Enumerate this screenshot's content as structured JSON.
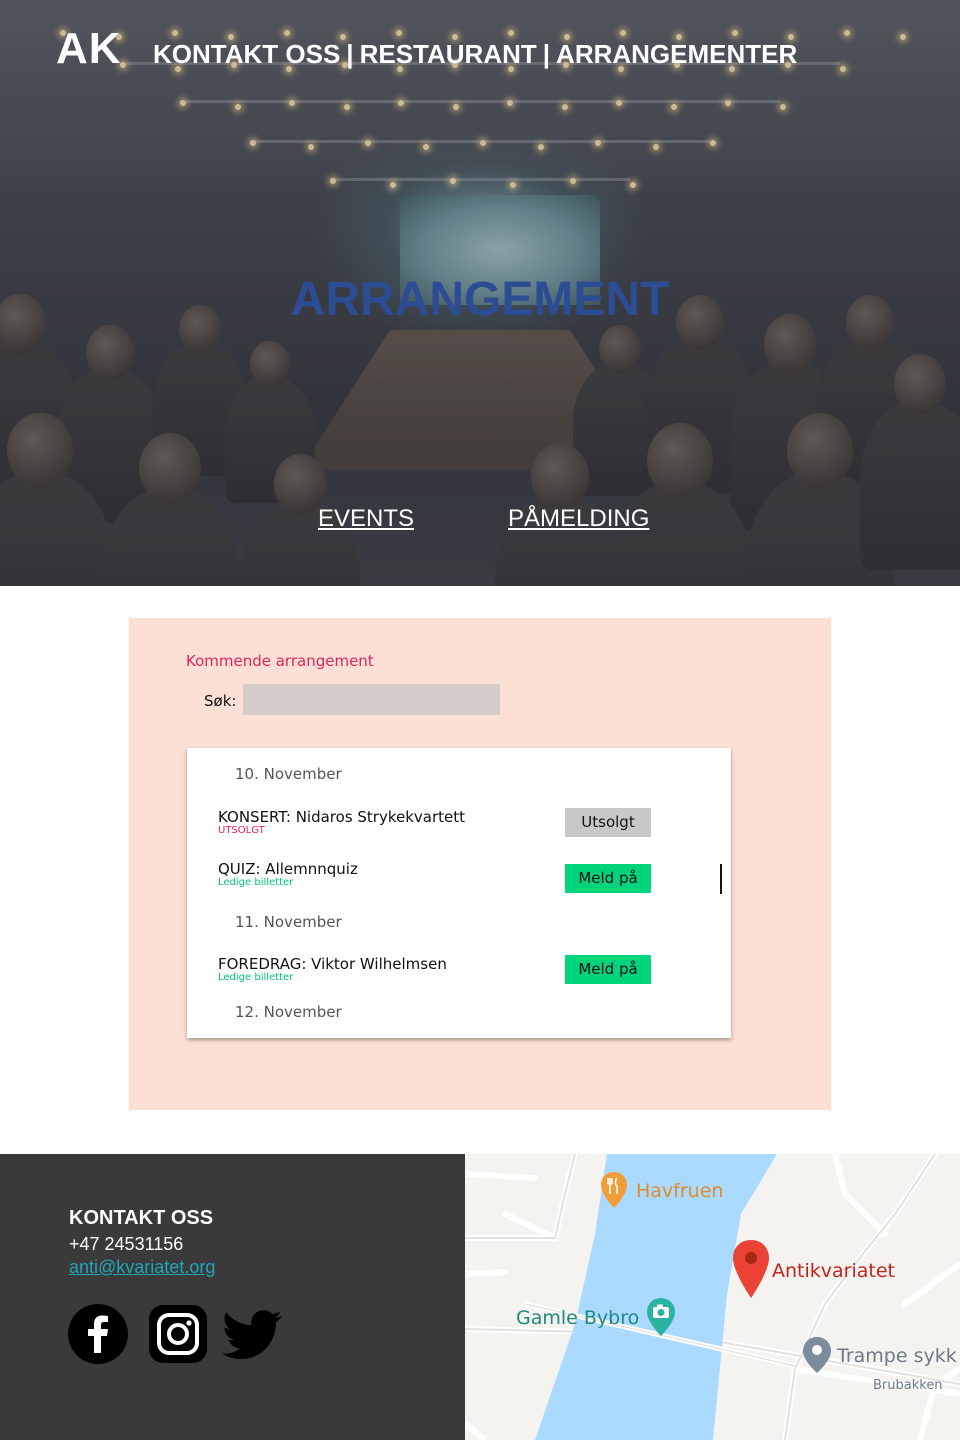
{
  "header": {
    "logo": "AK",
    "nav": [
      {
        "label": "KONTAKT OSS"
      },
      {
        "label": "RESTAURANT"
      },
      {
        "label": "ARRANGEMENTER"
      }
    ],
    "separator": "|"
  },
  "hero": {
    "title": "ARRANGEMENT",
    "links": {
      "events": "EVENTS",
      "signup": "PÅMELDING"
    }
  },
  "events": {
    "heading": "Kommende arrangement",
    "search": {
      "label": "Søk:",
      "value": "",
      "placeholder": ""
    },
    "dates": [
      "10. November",
      "11. November",
      "12. November"
    ],
    "items": [
      {
        "title": "KONSERT: Nidaros Strykekvartett",
        "status": "UTSOLGT",
        "button": "Utsolgt"
      },
      {
        "title": "QUIZ: Allemnnquiz",
        "status": "Ledige billetter",
        "button": "Meld på"
      },
      {
        "title": "FOREDRAG: Viktor Wilhelmsen",
        "status": "Ledige billetter",
        "button": "Meld på"
      }
    ],
    "colors": {
      "soldout_status": "#e0245e",
      "available_status": "#00c77a",
      "signup_button": "#00d47a",
      "soldout_button": "#c8c8c8"
    }
  },
  "footer": {
    "heading": "KONTAKT OSS",
    "phone": "+47 24531156",
    "email": "anti@kvariatet.org",
    "social": [
      {
        "icon": "facebook-icon"
      },
      {
        "icon": "instagram-icon"
      },
      {
        "icon": "twitter-icon"
      }
    ]
  },
  "map": {
    "places": {
      "restaurant": "Havfruen",
      "bridge": "Gamle Bybro",
      "venue": "Antikvariatet",
      "shop": "Trampe sykk",
      "street": "Brubakken"
    },
    "colors": {
      "river": "#aadaff",
      "pin": "#ea4335",
      "restaurant_pin": "#f29e38",
      "bridge_pin": "#28b4a0",
      "shop_pin": "#7b8c9c"
    }
  }
}
